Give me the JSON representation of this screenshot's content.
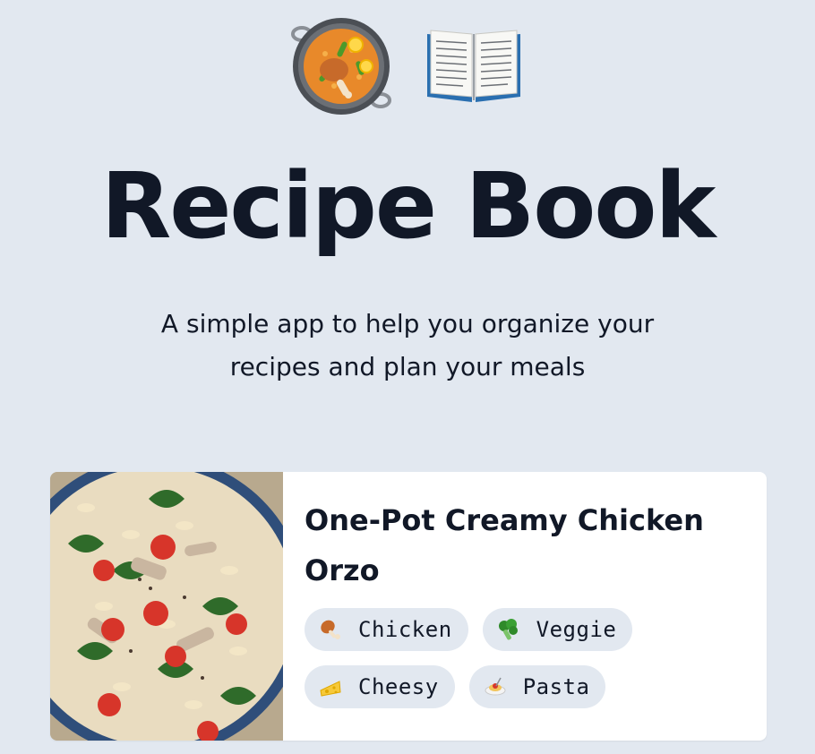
{
  "header": {
    "icons": [
      "paella-icon",
      "open-book-icon"
    ],
    "title": "Recipe Book",
    "subtitle_line1": "A simple app to help you organize your",
    "subtitle_line2": "recipes and plan your meals"
  },
  "recipes": [
    {
      "title": "One-Pot Creamy Chicken Orzo",
      "image": "creamy-chicken-orzo-photo",
      "tags": [
        {
          "label": "Chicken",
          "icon": "poultry-leg-icon"
        },
        {
          "label": "Veggie",
          "icon": "broccoli-icon"
        },
        {
          "label": "Cheesy",
          "icon": "cheese-icon"
        },
        {
          "label": "Pasta",
          "icon": "spaghetti-icon"
        }
      ]
    }
  ],
  "colors": {
    "background": "#e2e8f0",
    "card": "#ffffff",
    "text": "#111827",
    "tag_bg": "#e2e8f0"
  }
}
